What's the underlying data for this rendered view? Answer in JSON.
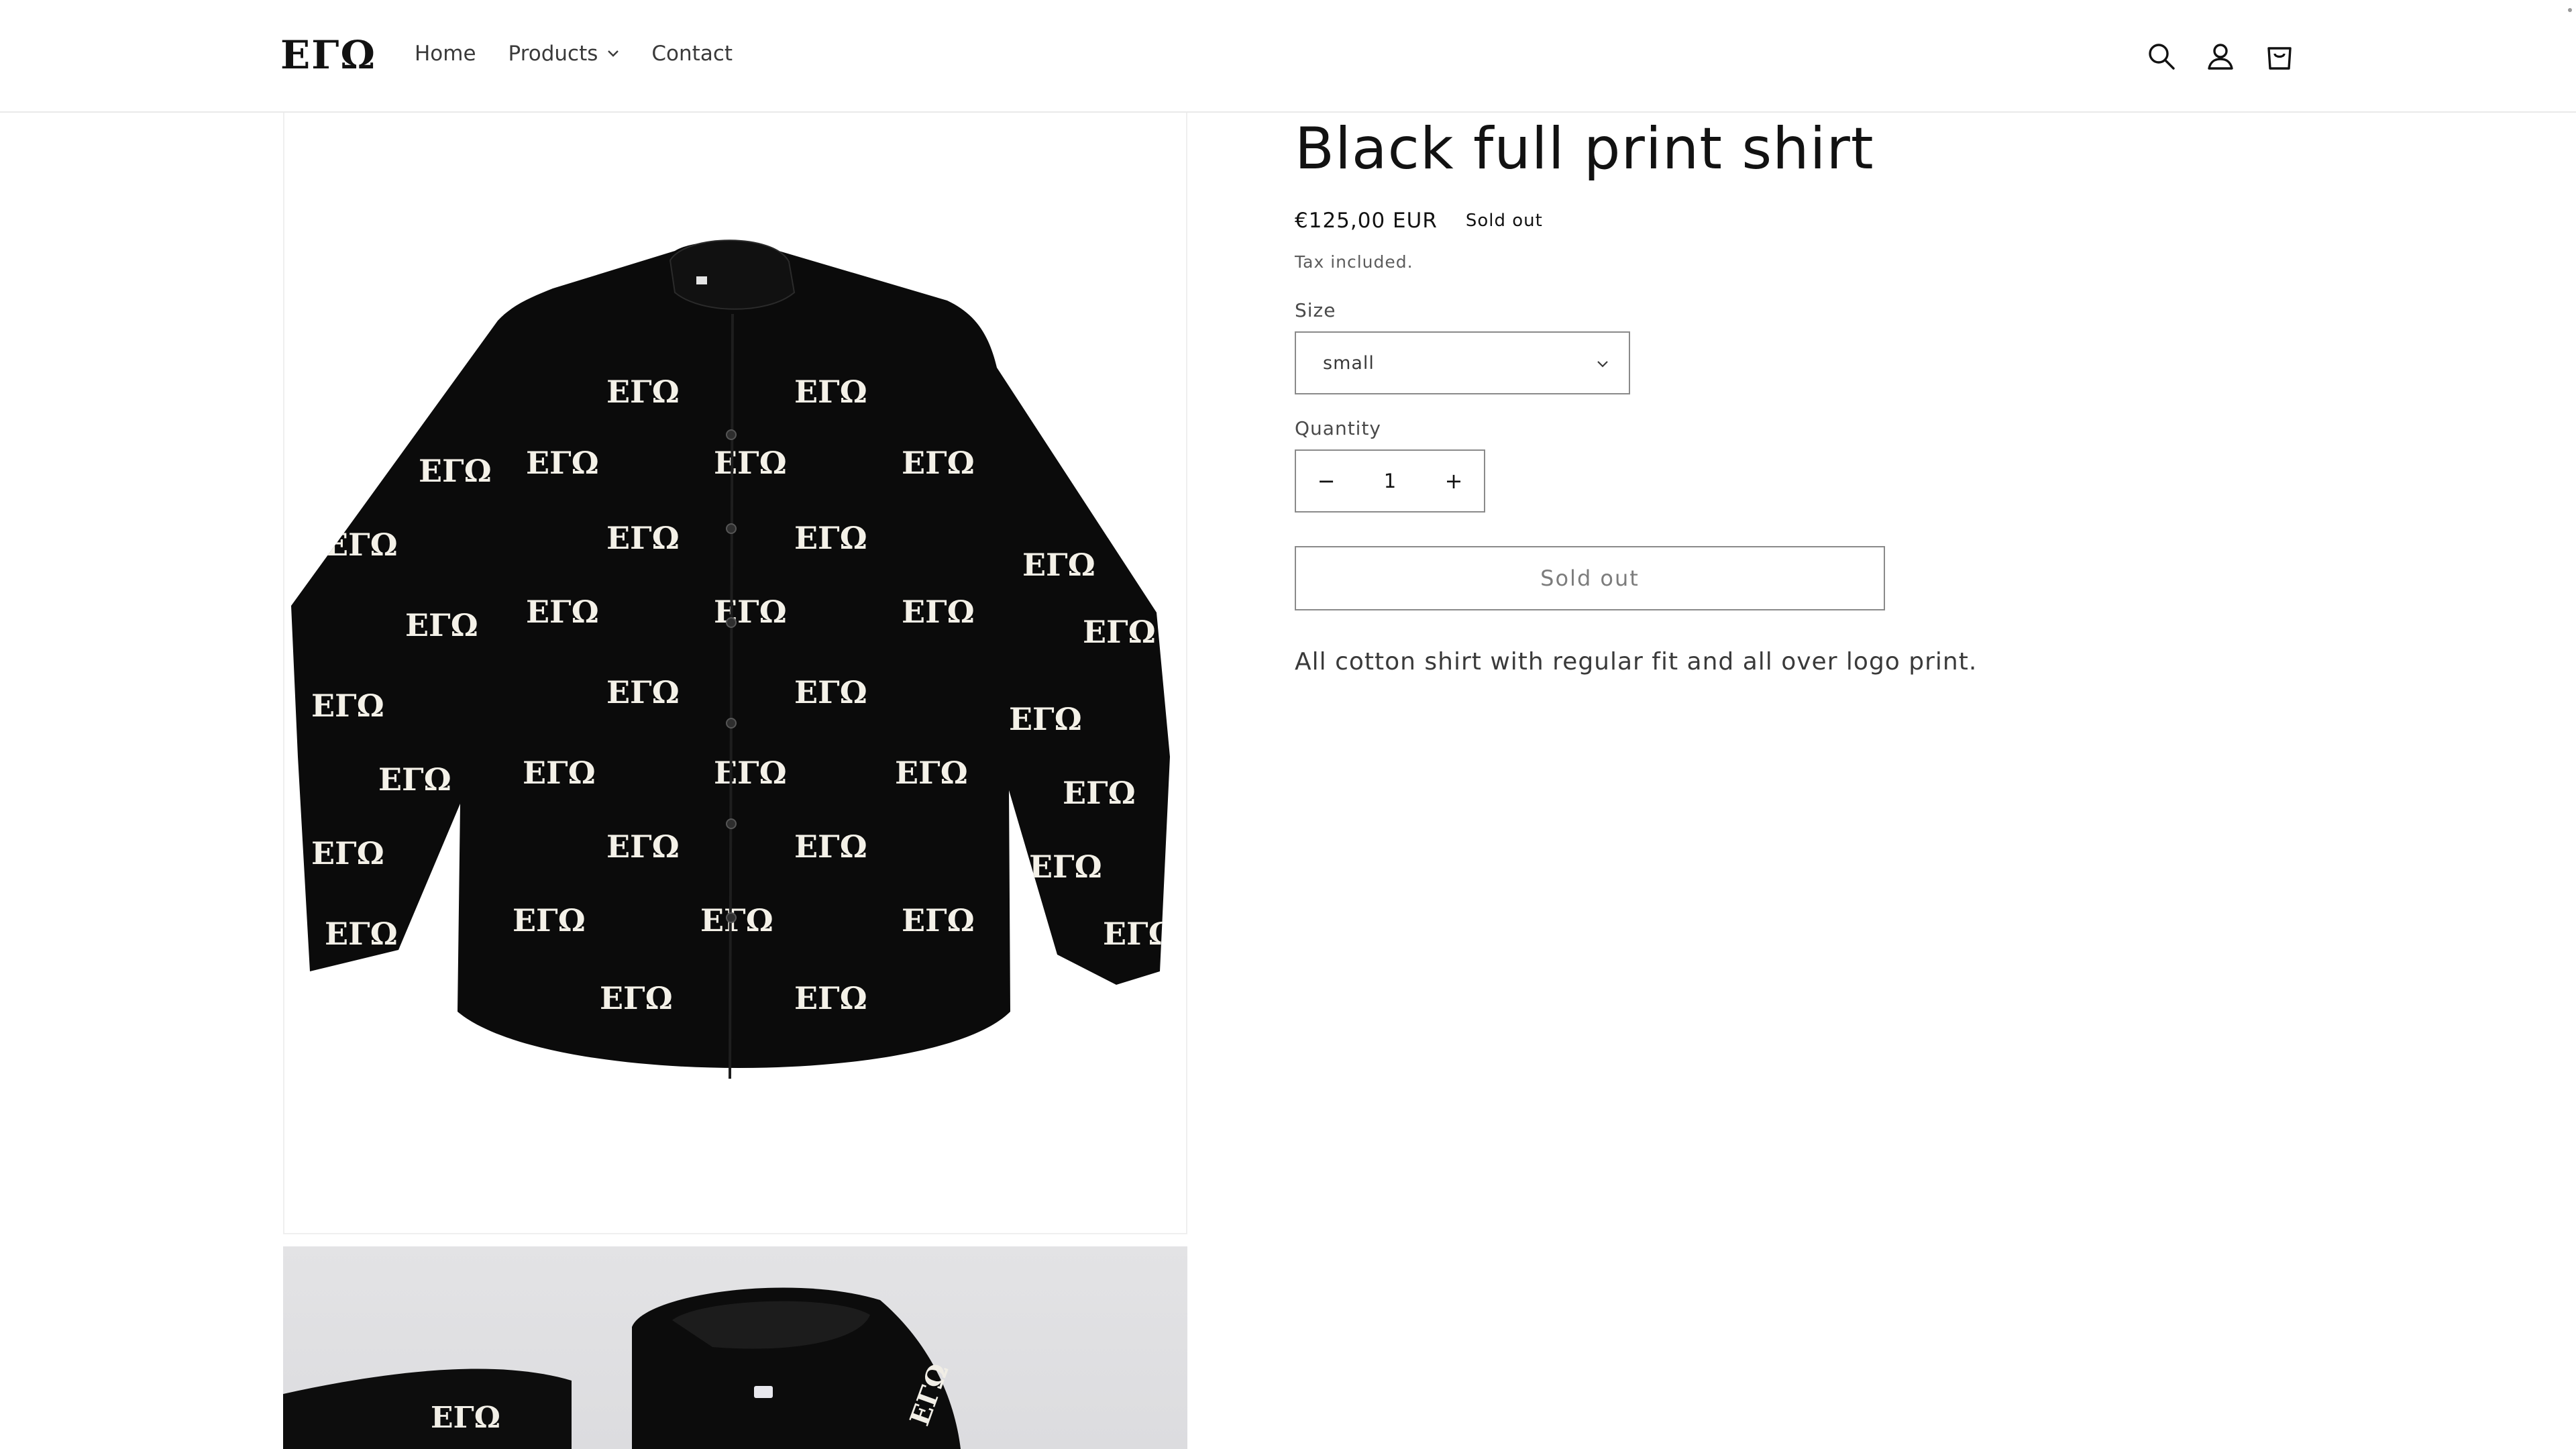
{
  "header": {
    "logo": "ΕΓΩ",
    "nav": [
      {
        "label": "Home"
      },
      {
        "label": "Products",
        "has_dropdown": true
      },
      {
        "label": "Contact"
      }
    ],
    "icons": [
      "search-icon",
      "account-icon",
      "cart-icon"
    ]
  },
  "product": {
    "title": "Black full print shirt",
    "price": "€125,00 EUR",
    "badge": "Sold out",
    "tax_note": "Tax included.",
    "size_label": "Size",
    "size_value": "small",
    "quantity_label": "Quantity",
    "quantity_value": "1",
    "decrease_symbol": "−",
    "increase_symbol": "+",
    "button_label": "Sold out",
    "description": "All cotton shirt with regular fit and all over logo print."
  },
  "media": {
    "shirt_print_text": "ΕΓΩ"
  },
  "colors": {
    "text": "#121212",
    "border": "#8a8a8a",
    "shirt": "#0b0b0b"
  }
}
